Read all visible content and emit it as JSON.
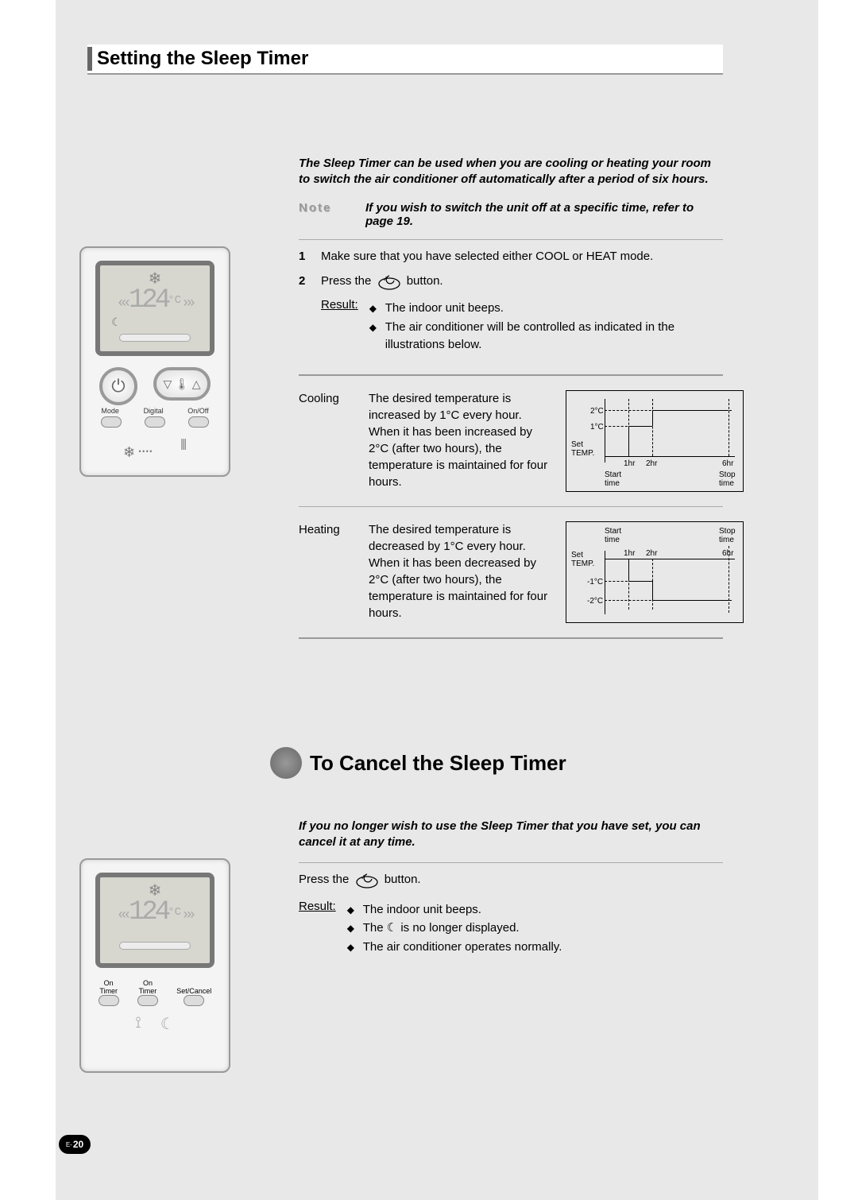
{
  "section1": {
    "title": "Setting the Sleep Timer",
    "intro": "The Sleep Timer can be used when you are cooling or heating your room to switch the air conditioner off automatically after a period of six hours.",
    "note_label": "Note",
    "note_text": "If you wish to switch the unit off at a specific time, refer to page 19.",
    "steps": [
      {
        "num": "1",
        "text": "Make sure that you have selected either COOL or HEAT mode."
      },
      {
        "num": "2",
        "pre": "Press the",
        "post": "button."
      }
    ],
    "result_label": "Result:",
    "result_items": [
      "The indoor unit beeps.",
      "The air conditioner will be controlled as indicated in the illustrations below."
    ],
    "modes": {
      "cooling": {
        "label": "Cooling",
        "desc": "The desired temperature is increased by 1°C every hour. When it has been increased by 2°C (after two hours), the temperature is maintained for four hours.",
        "y2": "2°C",
        "y1": "1°C",
        "set_label": "Set\nTEMP.",
        "h1": "1hr",
        "h2": "2hr",
        "h6": "6hr",
        "start": "Start\ntime",
        "stop": "Stop\ntime"
      },
      "heating": {
        "label": "Heating",
        "desc": "The desired temperature is decreased by 1°C every hour. When it has been decreased by 2°C (after two hours), the temperature is maintained for four hours.",
        "y1": "-1°C",
        "y2": "-2°C",
        "set_label": "Set\nTEMP.",
        "h1": "1hr",
        "h2": "2hr",
        "h6": "6hr",
        "start": "Start\ntime",
        "stop": "Stop\ntime"
      }
    }
  },
  "section2": {
    "title": "To Cancel the Sleep Timer",
    "intro": "If you no longer wish to use the Sleep Timer that you have set, you can cancel it at any time.",
    "press_pre": "Press the",
    "press_post": "button.",
    "result_label": "Result:",
    "result_items": [
      "The indoor unit beeps.",
      "The ☾ is no longer displayed.",
      "The air conditioner operates normally."
    ]
  },
  "remote": {
    "temp_digits": "124",
    "temp_unit": "°C",
    "mode_label": "Mode",
    "digital_label": "Digital",
    "onoff_label": "On/Off",
    "on_timer": "On\nTimer",
    "off_timer": "On\nTimer",
    "set_cancel": "Set/Cancel"
  },
  "page_number": "20",
  "page_prefix": "E-"
}
